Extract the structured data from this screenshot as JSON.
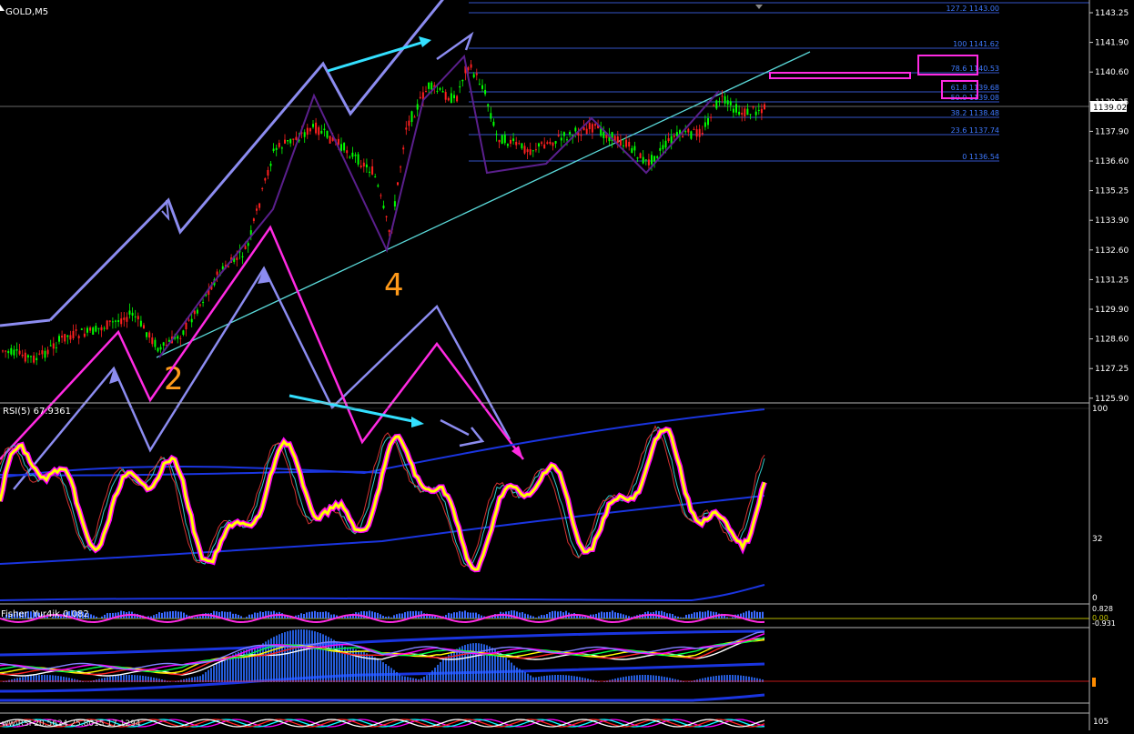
{
  "window": {
    "title": "GOLD,M5"
  },
  "colors": {
    "background": "#000000",
    "candle_up": "#00ff00",
    "candle_down": "#ff2020",
    "fib_line": "#3455c8",
    "fib_text": "#3e79ff",
    "trendline": "#5ad9d9",
    "wave_lavender": "#8c8cf0",
    "wave_magenta": "#ff2ae2",
    "wave_cyan": "#33e0ff",
    "wave_purple": "#5a1f8c",
    "wave_label": "#ff9a1a",
    "rsi_main": "#ffff00",
    "rsi_glow": "#ff00ff",
    "scale_text": "#ffffff",
    "panel_border": "#b4b4b4"
  },
  "main_panel": {
    "price_scale": [
      "1143.25",
      "1141.90",
      "1140.60",
      "1139.25",
      "1137.90",
      "1136.60",
      "1135.25",
      "1133.90",
      "1132.60",
      "1131.25",
      "1129.90",
      "1128.60",
      "1127.25",
      "1125.90"
    ],
    "current_price": "1139.02",
    "fib_levels": [
      {
        "label": "127.2 1143.00"
      },
      {
        "label": "100 1141.62"
      },
      {
        "label": "78.6 1140.53"
      },
      {
        "label": "61.8 1139.68"
      },
      {
        "label": "50.0 1139.08"
      },
      {
        "label": "38.2 1138.48"
      },
      {
        "label": "23.6 1137.74"
      },
      {
        "label": "0 1136.54"
      }
    ],
    "wave_labels": {
      "wave_2": "2",
      "wave_4": "4"
    }
  },
  "rsi_panel": {
    "title": "RSI(5) 67.9361",
    "scale": [
      "100",
      "32",
      "0"
    ]
  },
  "fisher_panel": {
    "title": "Fisher_Yur4ik 0.082",
    "scale": [
      "0.828",
      "0.00",
      "-0.931"
    ]
  },
  "bottom_panel": {
    "title": "ww\\RSI 20.5624 25.8015 17.1294",
    "scale": [
      "105"
    ]
  }
}
